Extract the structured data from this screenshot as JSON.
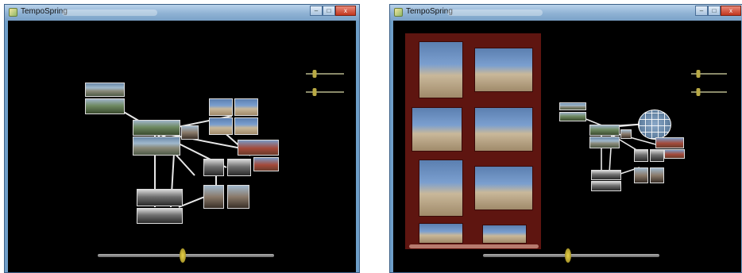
{
  "windows": [
    {
      "title": "TempoSpring",
      "controls": {
        "minimize": "–",
        "maximize": "□",
        "close": "x"
      }
    },
    {
      "title": "TempoSpring",
      "controls": {
        "minimize": "–",
        "maximize": "□",
        "close": "x"
      }
    }
  ],
  "icons": [
    "app-icon",
    "minimize-icon",
    "maximize-icon",
    "close-icon"
  ],
  "colors": {
    "background": "#000000",
    "drawer": "#5e1510",
    "slider_knob": "#b9aa45",
    "titlebar": "#8fb2d4"
  },
  "sliders": {
    "win1": {
      "top_level": 0.22,
      "bottom_level": 0.22,
      "timeline_position": 0.48
    },
    "win2": {
      "top_level": 0.2,
      "bottom_level": 0.2,
      "timeline_position": 0.48
    }
  }
}
